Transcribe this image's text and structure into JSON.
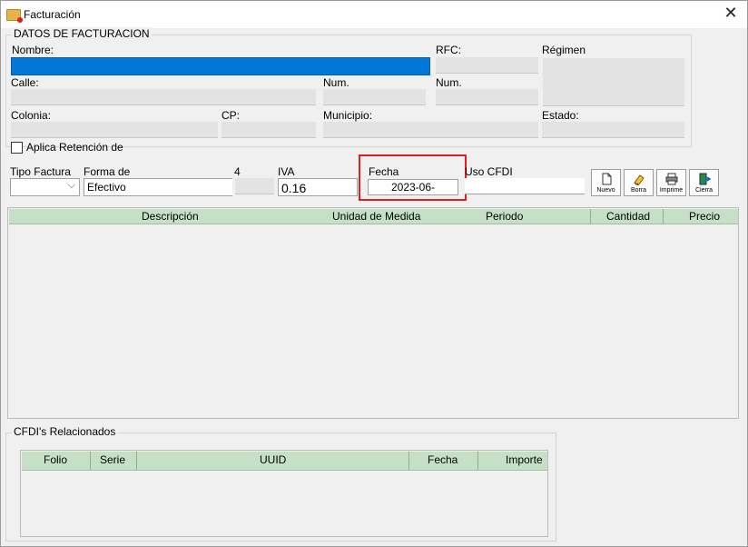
{
  "window": {
    "title": "Facturación",
    "app_icon": "folder-icon",
    "close_glyph": "✕"
  },
  "datos": {
    "legend": "DATOS DE FACTURACION",
    "nombre_label": "Nombre:",
    "nombre_value": "",
    "rfc_label": "RFC:",
    "regimen_label": "Régimen",
    "calle_label": "Calle:",
    "num_label_1": "Num.",
    "num_label_2": "Num.",
    "colonia_label": "Colonia:",
    "cp_label": "CP:",
    "municipio_label": "Municipio:",
    "estado_label": "Estado:"
  },
  "retencion": {
    "label": "Aplica Retención de",
    "checked": false
  },
  "factura": {
    "tipo_label": "Tipo Factura",
    "tipo_value": "",
    "forma_label": "Forma de",
    "forma_value": "Efectivo",
    "extra_number": "4",
    "iva_label": "IVA",
    "iva_value": "0.16",
    "fecha_label": "Fecha",
    "fecha_value": "2023-06-",
    "uso_label": "Uso CFDI",
    "uso_value": ""
  },
  "toolbar": {
    "nuevo": "Nuevo",
    "borra": "Borra",
    "imprime": "Imprime",
    "cierra": "Cierra"
  },
  "items_grid": {
    "columns": [
      "Descripción",
      "Unidad de Medida",
      "Periodo",
      "Cantidad",
      "Precio"
    ]
  },
  "cfdi": {
    "legend": "CFDI's Relacionados",
    "columns": [
      "Folio",
      "Serie",
      "UUID",
      "Fecha",
      "Importe"
    ]
  },
  "colors": {
    "selection": "#0078d7",
    "grid_header": "#c6e0c5",
    "highlight_box": "#e02020"
  }
}
